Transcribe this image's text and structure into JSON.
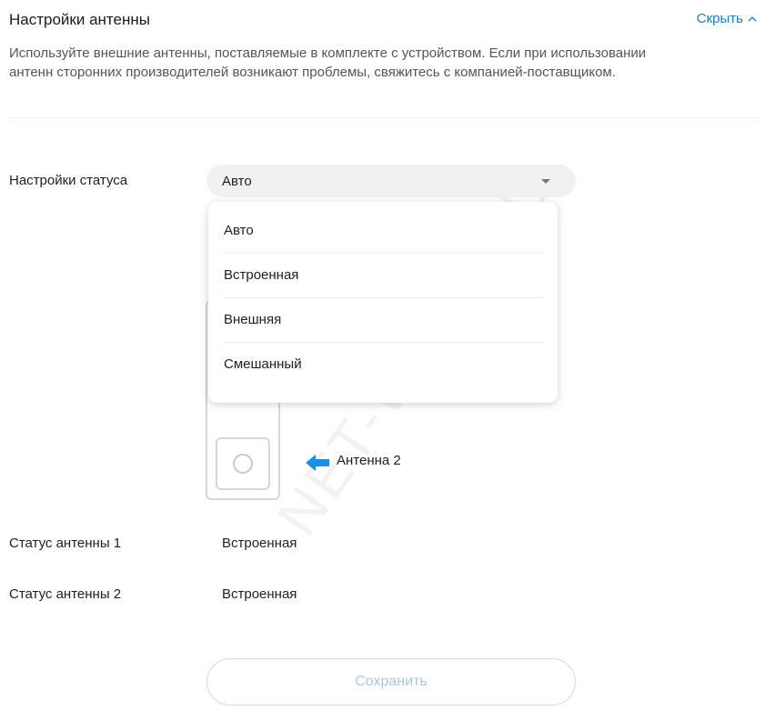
{
  "header": {
    "title": "Настройки антенны",
    "hide_label": "Скрыть",
    "description": "Используйте внешние антенны, поставляемые в комплекте с устройством. Если при использовании антенн сторонних производителей возникают проблемы, свяжитесь с компанией-поставщиком."
  },
  "status_settings": {
    "label": "Настройки статуса",
    "selected": "Авто",
    "options": [
      "Авто",
      "Встроенная",
      "Внешняя",
      "Смешанный"
    ]
  },
  "diagram": {
    "antenna2_label": "Антенна 2"
  },
  "antenna1": {
    "label": "Статус антенны 1",
    "value": "Встроенная"
  },
  "antenna2": {
    "label": "Статус антенны 2",
    "value": "Встроенная"
  },
  "save_label": "Сохранить",
  "colors": {
    "accent": "#1a7fc4",
    "arrow": "#1a8fe3",
    "save_text_disabled": "#a9c8e8"
  },
  "watermark": "NET-WELL.RU"
}
